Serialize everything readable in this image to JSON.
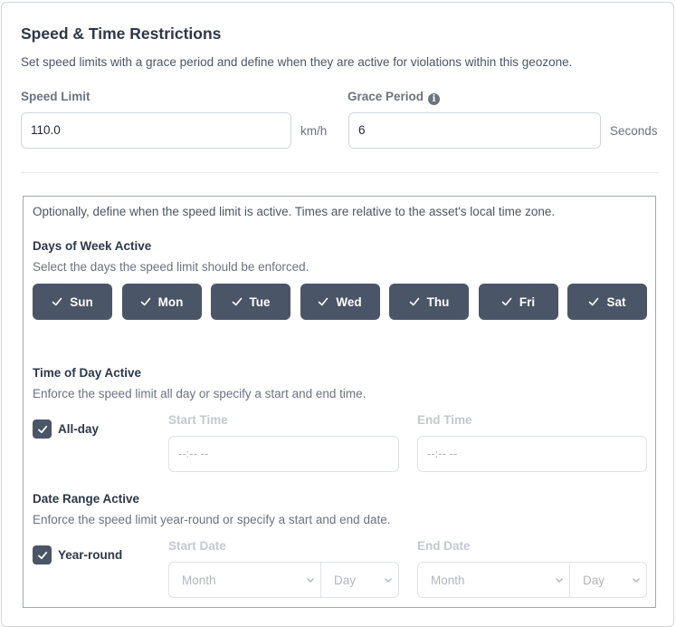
{
  "header": {
    "title": "Speed & Time Restrictions",
    "subtitle": "Set speed limits with a grace period and define when they are active for violations within this geozone."
  },
  "speed_limit": {
    "label": "Speed Limit",
    "value": "110.0",
    "unit": "km/h"
  },
  "grace_period": {
    "label": "Grace Period",
    "value": "6",
    "unit": "Seconds",
    "info_icon": "info-icon"
  },
  "schedule": {
    "note": "Optionally, define when the speed limit is active. Times are relative to the asset's local time zone.",
    "days": {
      "title": "Days of Week Active",
      "description": "Select the days the speed limit should be enforced.",
      "items": [
        {
          "label": "Sun",
          "selected": true
        },
        {
          "label": "Mon",
          "selected": true
        },
        {
          "label": "Tue",
          "selected": true
        },
        {
          "label": "Wed",
          "selected": true
        },
        {
          "label": "Thu",
          "selected": true
        },
        {
          "label": "Fri",
          "selected": true
        },
        {
          "label": "Sat",
          "selected": true
        }
      ]
    },
    "time": {
      "title": "Time of Day Active",
      "description": "Enforce the speed limit all day or specify a start and end time.",
      "all_day_label": "All-day",
      "all_day_checked": true,
      "start_label": "Start Time",
      "start_placeholder": "--:-- --",
      "end_label": "End Time",
      "end_placeholder": "--:-- --"
    },
    "date": {
      "title": "Date Range Active",
      "description": "Enforce the speed limit year-round or specify a start and end date.",
      "year_round_label": "Year-round",
      "year_round_checked": true,
      "start_label": "Start Date",
      "end_label": "End Date",
      "month_placeholder": "Month",
      "day_placeholder": "Day"
    }
  },
  "colors": {
    "accent": "#4a5567",
    "border": "#d1d5db",
    "disabled": "#c3c8cf"
  }
}
